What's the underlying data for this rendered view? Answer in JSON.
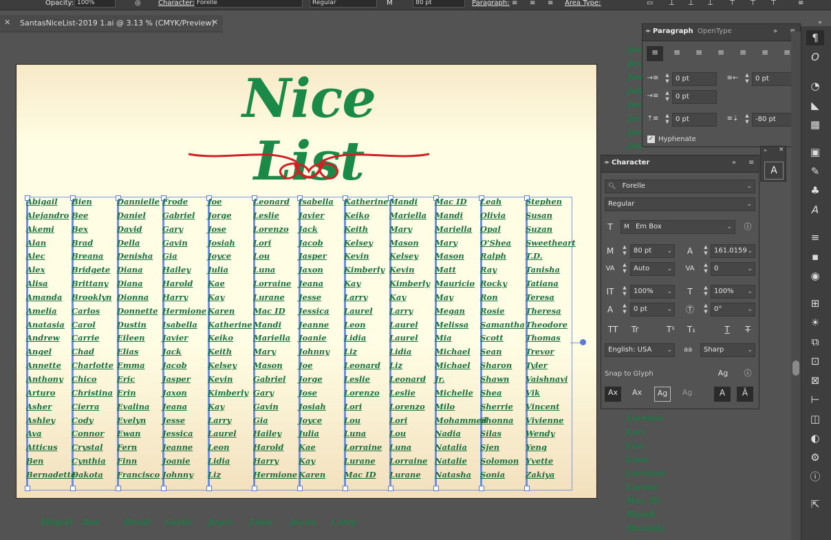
{
  "control_bar": {
    "opacity_label": "Opacity:",
    "opacity_value": "100%",
    "character_label": "Character:",
    "font_name": "Forelle",
    "font_style": "Regular",
    "font_size": "80 pt",
    "paragraph_label": "Paragraph:",
    "area_type_label": "Area Type:"
  },
  "doc_tab": {
    "title": "SantasNiceList-2019 1.ai @ 3.13 % (CMYK/Preview)"
  },
  "artboard": {
    "title": "Nice List",
    "columns": [
      [
        "Abigail",
        "Alejandro",
        "Akemi",
        "Alan",
        "Alec",
        "Alex",
        "Alisa",
        "Amanda",
        "Amelia",
        "Anatasia",
        "Andrew",
        "Angel",
        "Annette",
        "Anthony",
        "Arturo",
        "Asher",
        "Ashley",
        "Ava",
        "Atticus",
        "Ben",
        "Bernadette"
      ],
      [
        "Bien",
        "Bee",
        "Bex",
        "Brad",
        "Breana",
        "Bridgete",
        "Brittany",
        "Brooklyn",
        "Carlos",
        "Carol",
        "Carrie",
        "Chad",
        "Charlotte",
        "Chico",
        "Christina",
        "Cierra",
        "Cody",
        "Connor",
        "Crystal",
        "Cynthia",
        "Dakota"
      ],
      [
        "Dannielle",
        "Daniel",
        "David",
        "Della",
        "Denisha",
        "Diana",
        "Diana",
        "Dionna",
        "Donnette",
        "Dustin",
        "Eileen",
        "Elias",
        "Emma",
        "Eric",
        "Erin",
        "Evalina",
        "Evelyn",
        "Ewan",
        "Fern",
        "Finn",
        "Francisco"
      ],
      [
        "Frode",
        "Gabriel",
        "Gary",
        "Gavin",
        "Gia",
        "Hailey",
        "Harold",
        "Harry",
        "Hermione",
        "Isabella",
        "Javier",
        "Jack",
        "Jacob",
        "Jasper",
        "Jaxon",
        "Jeana",
        "Jesse",
        "Jessica",
        "Jeanne",
        "Joanie",
        "Johnny"
      ],
      [
        "Joe",
        "Jorge",
        "Jose",
        "Josiah",
        "Joyce",
        "Julia",
        "Kae",
        "Kay",
        "Karen",
        "Katherine",
        "Keiko",
        "Keith",
        "Kelsey",
        "Kevin",
        "Kimberly",
        "Kay",
        "Larry",
        "Laurel",
        "Leon",
        "Lidia",
        "Liz"
      ],
      [
        "Leonard",
        "Leslie",
        "Lorenzo",
        "Lori",
        "Lou",
        "Luna",
        "Lorraine",
        "Lurane",
        "Mac ID",
        "Mandi",
        "Mariella",
        "Mary",
        "Mason",
        "Gabriel",
        "Gary",
        "Gavin",
        "Gia",
        "Hailey",
        "Harold",
        "Harry",
        "Hermione"
      ],
      [
        "Isabella",
        "Javier",
        "Jack",
        "Jacob",
        "Jasper",
        "Jaxon",
        "Jeana",
        "Jesse",
        "Jessica",
        "Jeanne",
        "Joanie",
        "Johnny",
        "Joe",
        "Jorge",
        "Jose",
        "Josiah",
        "Joyce",
        "Julia",
        "Kae",
        "Kay",
        "Karen"
      ],
      [
        "Katherine",
        "Keiko",
        "Keith",
        "Kelsey",
        "Kevin",
        "Kimberly",
        "Kay",
        "Larry",
        "Laurel",
        "Leon",
        "Lidia",
        "Liz",
        "Leonard",
        "Leslie",
        "Lorenzo",
        "Lori",
        "Lou",
        "Luna",
        "Lorraine",
        "Lurane",
        "Mac ID"
      ],
      [
        "Mandi",
        "Mariella",
        "Mary",
        "Mason",
        "Kelsey",
        "Kevin",
        "Kimberly",
        "Kay",
        "Larry",
        "Laurel",
        "Laurel",
        "Lidia",
        "Liz",
        "Leonard",
        "Leslie",
        "Lorenzo",
        "Lori",
        "Lou",
        "Luna",
        "Lorraine",
        "Lurane"
      ],
      [
        "Mac ID",
        "Mandi",
        "Mariella",
        "Mary",
        "Mason",
        "Matt",
        "Mauricio",
        "May",
        "Megan",
        "Melissa",
        "Mia",
        "Michael",
        "Michael",
        "Jr.",
        "Michelle",
        "Milo",
        "Mohammed",
        "Nadia",
        "Natalia",
        "Natalie",
        "Natasha"
      ],
      [
        "Leah",
        "Olivia",
        "Opal",
        "O'Shea",
        "Ralph",
        "Ray",
        "Rocky",
        "Ron",
        "Rosie",
        "Samantha",
        "Scott",
        "Sean",
        "Sharon",
        "Shawn",
        "Shea",
        "Sherrie",
        "Shonna",
        "Silas",
        "Sjen",
        "Solomon",
        "Sonia"
      ],
      [
        "Stephen",
        "Susan",
        "Suzan",
        "Sweetheart",
        "T.D.",
        "Tanisha",
        "Tatiana",
        "Teresa",
        "Theresa",
        "Theodore",
        "Thomas",
        "Trevor",
        "Tyler",
        "Vaishnavi",
        "Vik",
        "Vincent",
        "Vivienne",
        "Wendy",
        "Yeng",
        "Yvette",
        "Zakiya"
      ]
    ]
  },
  "pasteboard_bottom": [
    "Abigail",
    "Bee",
    "David",
    "Gavin",
    "Joyce",
    "Luna",
    "Jeana",
    "Larry"
  ],
  "pasteboard_right": [
    "Lorenzo",
    "Lori",
    "Lou",
    "Luna",
    "Lorraine",
    "Lurane",
    "Mac ID",
    "Mandi",
    "Mariella"
  ],
  "pasteboard_right_top": [
    "Jess",
    "Jess",
    "Joan",
    "John",
    "Joe",
    "Jorg",
    "Jose",
    "Josi"
  ],
  "paragraph_panel": {
    "tab_active": "Paragraph",
    "tab_inactive": "OpenType",
    "left_indent": "0 pt",
    "right_indent": "0 pt",
    "first_line_indent": "0 pt",
    "space_before": "0 pt",
    "space_after": "-80 pt",
    "hyphenate_label": "Hyphenate",
    "hyphenate_checked": true
  },
  "character_panel": {
    "tab": "Character",
    "font_family": "Forelle",
    "font_style": "Regular",
    "em_box": "Em Box",
    "font_size": "80 pt",
    "leading": "161.0159",
    "kerning": "Auto",
    "tracking": "0",
    "vertical_scale": "100%",
    "horizontal_scale": "100%",
    "baseline_shift": "0 pt",
    "rotation": "0°",
    "language": "English: USA",
    "antialias": "Sharp",
    "snap_to_glyph_label": "Snap to Glyph",
    "aa_label": "aa"
  }
}
